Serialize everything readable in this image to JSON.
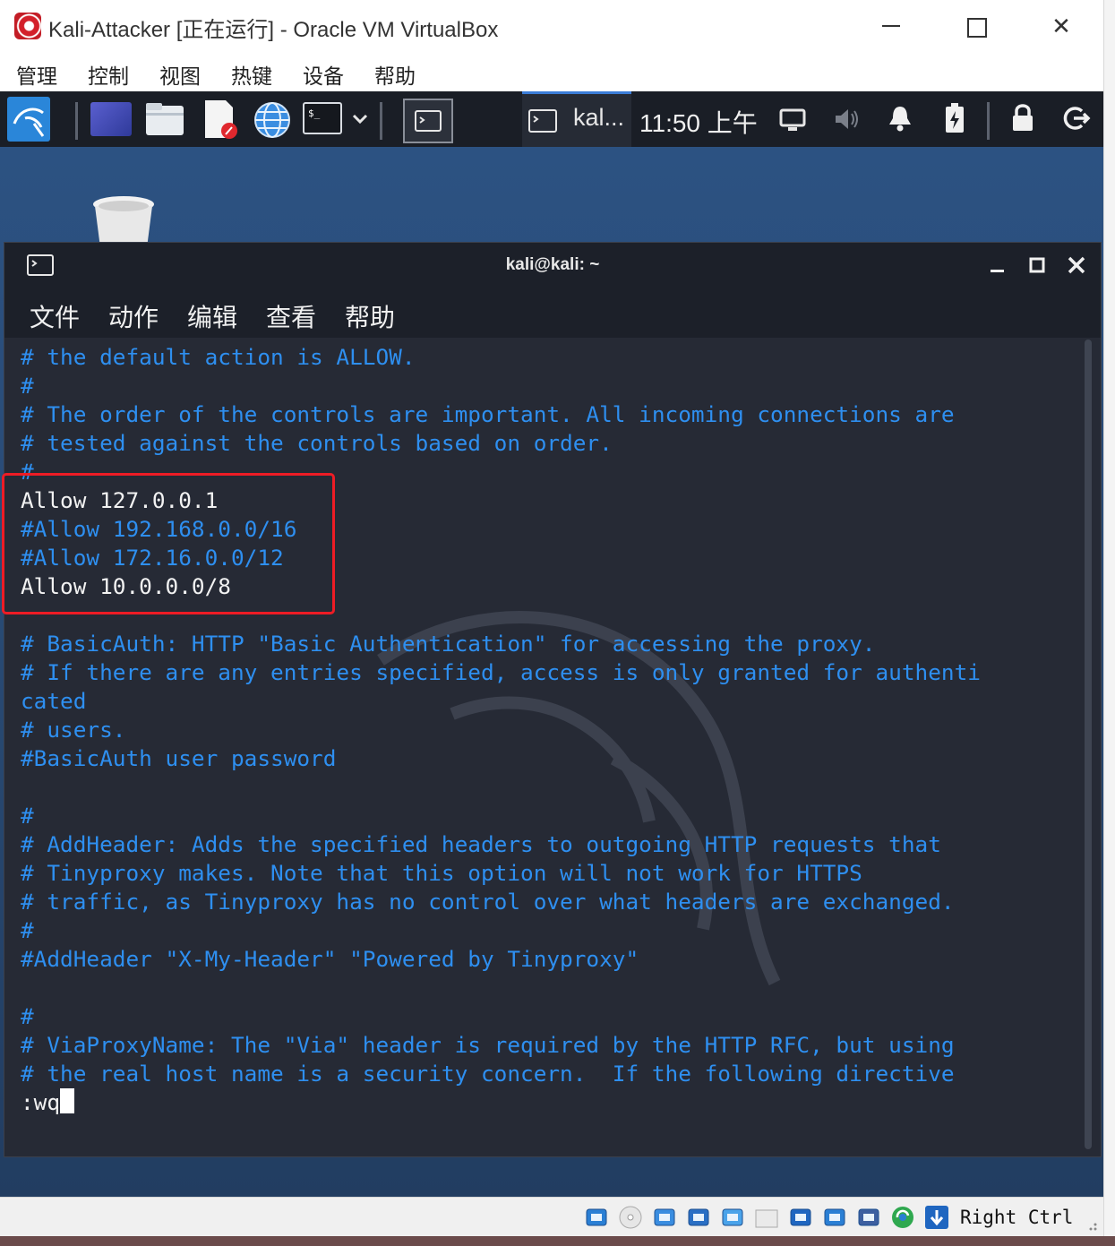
{
  "host_window": {
    "title": "Kali-Attacker [正在运行] - Oracle VM VirtualBox",
    "controls": {
      "minimize": "—",
      "maximize": "",
      "close": "✕"
    }
  },
  "host_menu": [
    "管理",
    "控制",
    "视图",
    "热键",
    "设备",
    "帮助"
  ],
  "panel": {
    "taskbar_item_label": "kal...",
    "clock": "11:50 上午"
  },
  "terminal": {
    "title": "kali@kali: ~",
    "menu": [
      "文件",
      "动作",
      "编辑",
      "查看",
      "帮助"
    ],
    "lines": [
      {
        "text": "# the default action is ALLOW.",
        "color": "#2e8ff0"
      },
      {
        "text": "#",
        "color": "#2e8ff0"
      },
      {
        "text": "# The order of the controls are important. All incoming connections are",
        "color": "#2e8ff0"
      },
      {
        "text": "# tested against the controls based on order.",
        "color": "#2e8ff0"
      },
      {
        "text": "#",
        "color": "#2e8ff0"
      },
      {
        "text": "Allow 127.0.0.1",
        "color": "#f2f2f2"
      },
      {
        "text": "#Allow 192.168.0.0/16",
        "color": "#2e8ff0"
      },
      {
        "text": "#Allow 172.16.0.0/12",
        "color": "#2e8ff0"
      },
      {
        "text": "Allow 10.0.0.0/8",
        "color": "#f2f2f2"
      },
      {
        "text": "",
        "color": "#2e8ff0"
      },
      {
        "text": "# BasicAuth: HTTP \"Basic Authentication\" for accessing the proxy.",
        "color": "#2e8ff0"
      },
      {
        "text": "# If there are any entries specified, access is only granted for authenti",
        "color": "#2e8ff0"
      },
      {
        "text": "cated",
        "color": "#2e8ff0"
      },
      {
        "text": "# users.",
        "color": "#2e8ff0"
      },
      {
        "text": "#BasicAuth user password",
        "color": "#2e8ff0"
      },
      {
        "text": "",
        "color": "#2e8ff0"
      },
      {
        "text": "#",
        "color": "#2e8ff0"
      },
      {
        "text": "# AddHeader: Adds the specified headers to outgoing HTTP requests that",
        "color": "#2e8ff0"
      },
      {
        "text": "# Tinyproxy makes. Note that this option will not work for HTTPS",
        "color": "#2e8ff0"
      },
      {
        "text": "# traffic, as Tinyproxy has no control over what headers are exchanged.",
        "color": "#2e8ff0"
      },
      {
        "text": "#",
        "color": "#2e8ff0"
      },
      {
        "text": "#AddHeader \"X-My-Header\" \"Powered by Tinyproxy\"",
        "color": "#2e8ff0"
      },
      {
        "text": "",
        "color": "#2e8ff0"
      },
      {
        "text": "#",
        "color": "#2e8ff0"
      },
      {
        "text": "# ViaProxyName: The \"Via\" header is required by the HTTP RFC, but using",
        "color": "#2e8ff0"
      },
      {
        "text": "# the real host name is a security concern.  If the following directive",
        "color": "#2e8ff0"
      }
    ],
    "command_line": ":wq"
  },
  "statusbar": {
    "host_key": "Right Ctrl",
    "icons": [
      "hard-disk-icon",
      "optical-drive-icon",
      "audio-icon",
      "network-icon",
      "usb-icon",
      "shared-folders-icon",
      "display-icon",
      "video-capture-icon",
      "virtualization-icon",
      "guest-additions-icon",
      "host-key-arrow-icon"
    ]
  },
  "colors": {
    "terminal_bg": "#262a35",
    "comment_text": "#2e8ff0",
    "active_text": "#f2f2f2",
    "highlight_box": "#ee1c25",
    "panel_bg": "#1a1e26"
  }
}
